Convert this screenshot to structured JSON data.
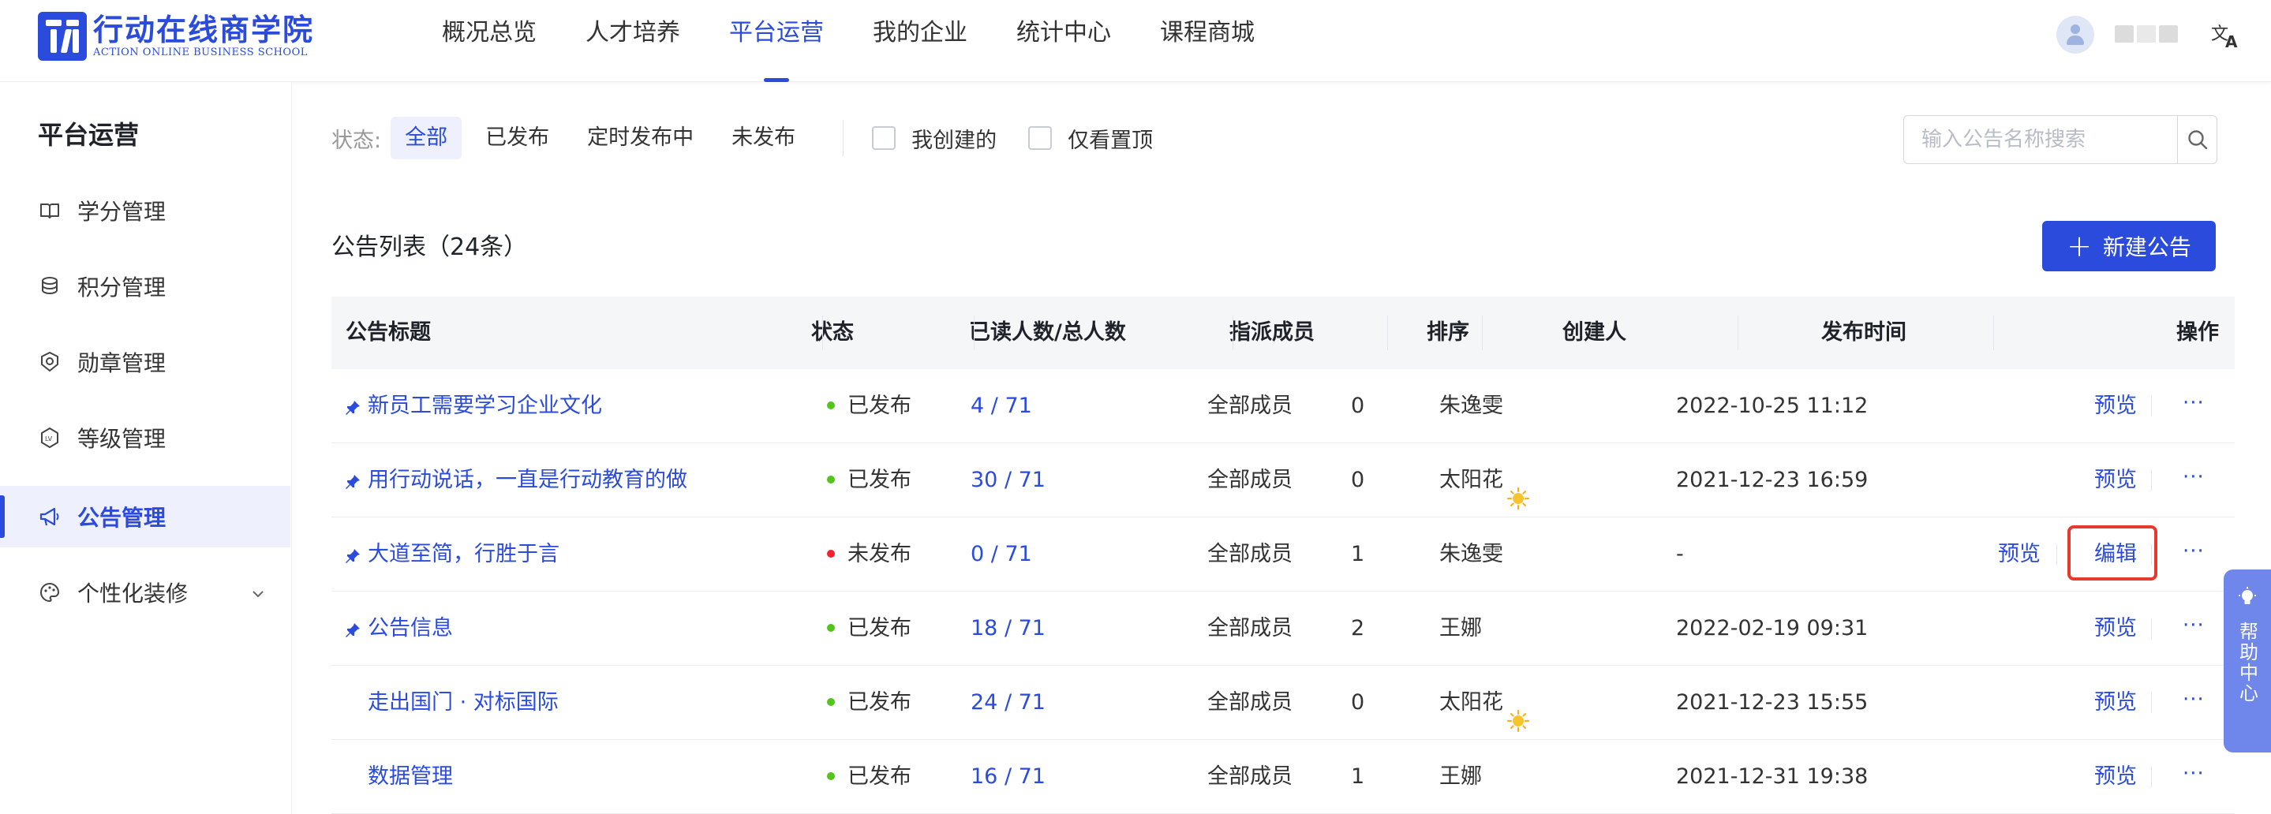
{
  "header": {
    "logo_cn": "行动在线商学院",
    "logo_en": "ACTION ONLINE BUSINESS SCHOOL",
    "nav": [
      {
        "label": "概况总览",
        "active": false
      },
      {
        "label": "人才培养",
        "active": false
      },
      {
        "label": "平台运营",
        "active": true
      },
      {
        "label": "我的企业",
        "active": false
      },
      {
        "label": "统计中心",
        "active": false
      },
      {
        "label": "课程商城",
        "active": false
      }
    ],
    "icons": {
      "avatar": "user-avatar-icon",
      "language": "translate-icon"
    }
  },
  "sidebar": {
    "title": "平台运营",
    "items": [
      {
        "label": "学分管理",
        "icon": "book-icon",
        "active": false
      },
      {
        "label": "积分管理",
        "icon": "coins-icon",
        "active": false
      },
      {
        "label": "勋章管理",
        "icon": "medal-icon",
        "active": false
      },
      {
        "label": "等级管理",
        "icon": "level-icon",
        "active": false
      },
      {
        "label": "公告管理",
        "icon": "megaphone-icon",
        "active": true
      },
      {
        "label": "个性化装修",
        "icon": "palette-icon",
        "active": false,
        "expandable": true
      }
    ]
  },
  "filters": {
    "status_label": "状态:",
    "status_options": [
      {
        "label": "全部",
        "active": true
      },
      {
        "label": "已发布",
        "active": false
      },
      {
        "label": "定时发布中",
        "active": false
      },
      {
        "label": "未发布",
        "active": false
      }
    ],
    "checkboxes": [
      {
        "label": "我创建的",
        "checked": false
      },
      {
        "label": "仅看置顶",
        "checked": false
      }
    ],
    "search_placeholder": "输入公告名称搜索"
  },
  "list": {
    "title": "公告列表（24条）",
    "new_button": "新建公告"
  },
  "table": {
    "columns": [
      "公告标题",
      "状态",
      "已读人数/总人数",
      "指派成员",
      "排序",
      "创建人",
      "发布时间",
      "操作"
    ],
    "rows": [
      {
        "title": "新员工需要学习企业文化",
        "pinned": true,
        "status": "已发布",
        "status_color": "#52c41a",
        "read": "4 / 71",
        "assigned": "全部成员",
        "order": "0",
        "creator": "朱逸雯",
        "creator_sun": false,
        "time": "2022-10-25 11:12",
        "actions": [
          "预览"
        ]
      },
      {
        "title": "用行动说话，一直是行动教育的做",
        "pinned": true,
        "status": "已发布",
        "status_color": "#52c41a",
        "read": "30 / 71",
        "assigned": "全部成员",
        "order": "0",
        "creator": "太阳花",
        "creator_sun": true,
        "time": "2021-12-23 16:59",
        "actions": [
          "预览"
        ]
      },
      {
        "title": "大道至简，行胜于言",
        "pinned": true,
        "status": "未发布",
        "status_color": "#f5222d",
        "read": "0 / 71",
        "assigned": "全部成员",
        "order": "1",
        "creator": "朱逸雯",
        "creator_sun": false,
        "time": "-",
        "actions": [
          "预览",
          "编辑"
        ]
      },
      {
        "title": "公告信息",
        "pinned": true,
        "status": "已发布",
        "status_color": "#52c41a",
        "read": "18 / 71",
        "assigned": "全部成员",
        "order": "2",
        "creator": "王娜",
        "creator_sun": false,
        "time": "2022-02-19 09:31",
        "actions": [
          "预览"
        ]
      },
      {
        "title": "走出国门 · 对标国际",
        "pinned": false,
        "status": "已发布",
        "status_color": "#52c41a",
        "read": "24 / 71",
        "assigned": "全部成员",
        "order": "0",
        "creator": "太阳花",
        "creator_sun": true,
        "time": "2021-12-23 15:55",
        "actions": [
          "预览"
        ]
      },
      {
        "title": "数据管理",
        "pinned": false,
        "status": "已发布",
        "status_color": "#52c41a",
        "read": "16 / 71",
        "assigned": "全部成员",
        "order": "1",
        "creator": "王娜",
        "creator_sun": false,
        "time": "2021-12-31 19:38",
        "actions": [
          "预览"
        ]
      }
    ],
    "more_label": "···"
  },
  "help": {
    "label": "帮助中心",
    "icon": "lightbulb-icon"
  },
  "colors": {
    "accent": "#2b4bdc",
    "published": "#52c41a",
    "unpublished": "#f5222d",
    "highlight": "#e53b2c"
  }
}
